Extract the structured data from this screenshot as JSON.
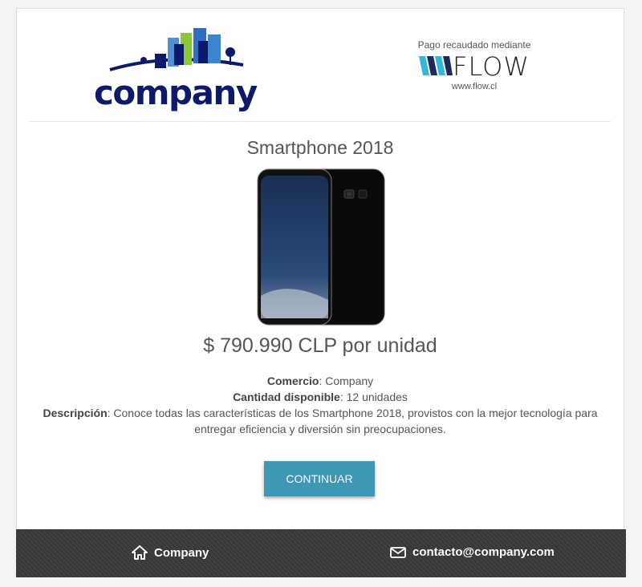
{
  "header": {
    "merchant_logo_text": "company",
    "flow_tagline": "Pago recaudado mediante",
    "flow_brand": "FLOW",
    "flow_url": "www.flow.cl"
  },
  "product": {
    "title": "Smartphone 2018",
    "price": "$ 790.990 CLP por unidad",
    "comercio_label": "Comercio",
    "comercio_value": "Company",
    "cantidad_label": "Cantidad disponible",
    "cantidad_value": "12 unidades",
    "descripcion_label": "Descripción",
    "descripcion_value": "Conoce todas las características de los Smartphone 2018, provistos con la mejor tecnología para entregar eficiencia y diversión sin preocupaciones."
  },
  "actions": {
    "continue_label": "CONTINUAR"
  },
  "footer": {
    "home_label": "Company",
    "email_label": "contacto@company.com"
  },
  "colors": {
    "accent": "#3f97b5",
    "brand_navy": "#0d1a6b",
    "footer_bg": "#3a3a3a"
  },
  "icons": {
    "home": "home-icon",
    "email": "envelope-icon"
  }
}
